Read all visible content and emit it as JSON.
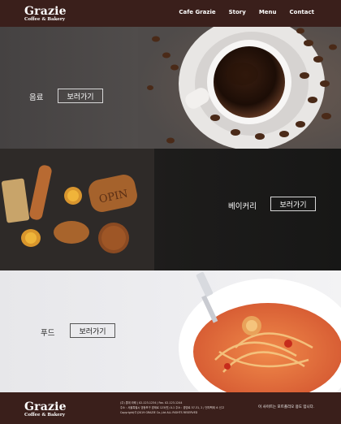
{
  "header": {
    "logo_main": "Grazie",
    "logo_sub": "Coffee & Bakery",
    "nav": [
      "Cafe Grazie",
      "Story",
      "Menu",
      "Contact"
    ]
  },
  "sections": {
    "drink": {
      "label": "음료",
      "button": "보러가기"
    },
    "bakery": {
      "label": "베이커리",
      "button": "보러가기"
    },
    "food": {
      "label": "푸드",
      "button": "보러가기"
    }
  },
  "footer": {
    "logo_main": "Grazie",
    "logo_sub": "Coffee & Bakery",
    "info_line1": "(주) 롯데 라떼 | 02-123-1234 | Fax. 02-123-1244",
    "info_line2": "주소 : 서울특별시 영등포구 경제로 123(빈) 0-1 주소 : 경영로 57-31, 2 / 전자팩제 소 신고",
    "info_line3": "Copyright(©)2019 GRAZIE Co.,Ltd ALL RIGHTS RESERVED",
    "note": "이 사이트는 포트폴리오 용도 입니다."
  },
  "colors": {
    "header_bg": "#3a1f1b",
    "drink_bg": "#4f4b4a",
    "bakery_bg": "#1d1c1b",
    "food_bg": "#ececee",
    "sauce": "#e0623a"
  }
}
